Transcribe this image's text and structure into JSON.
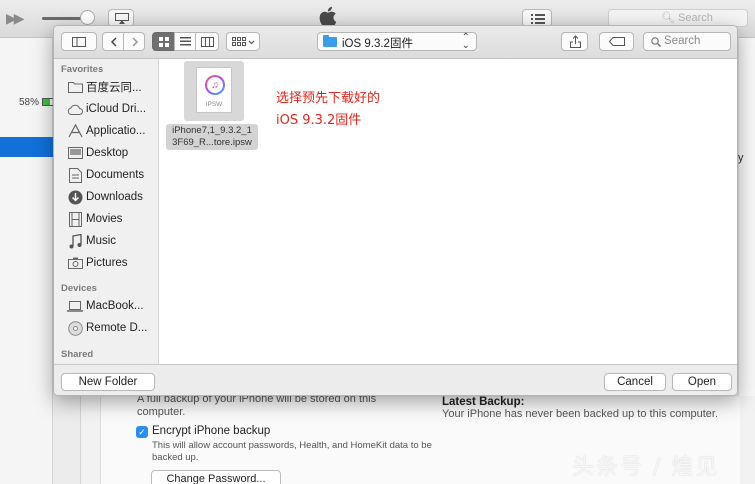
{
  "itunes": {
    "search_placeholder": "Search",
    "battery_percent": "58%",
    "backup": {
      "description": "A full backup of your iPhone will be stored on this computer.",
      "encrypt_label": "Encrypt iPhone backup",
      "encrypt_checked": true,
      "encrypt_description": "This will allow account passwords, Health, and HomeKit data to be backed up.",
      "change_password_label": "Change Password...",
      "latest_backup_title": "Latest Backup:",
      "latest_backup_text": "Your iPhone has never been backed up to this computer."
    },
    "right_edge_char": "y"
  },
  "dialog": {
    "location": "iOS 9.3.2固件",
    "search_placeholder": "Search",
    "sidebar": {
      "favorites_header": "Favorites",
      "favorites": [
        {
          "label": "百度云同...",
          "icon": "folder-icon"
        },
        {
          "label": "iCloud Dri...",
          "icon": "cloud-icon"
        },
        {
          "label": "Applicatio...",
          "icon": "applications-icon"
        },
        {
          "label": "Desktop",
          "icon": "desktop-icon"
        },
        {
          "label": "Documents",
          "icon": "documents-icon"
        },
        {
          "label": "Downloads",
          "icon": "downloads-icon"
        },
        {
          "label": "Movies",
          "icon": "movies-icon"
        },
        {
          "label": "Music",
          "icon": "music-icon"
        },
        {
          "label": "Pictures",
          "icon": "pictures-icon"
        }
      ],
      "devices_header": "Devices",
      "devices": [
        {
          "label": "MacBook...",
          "icon": "laptop-icon"
        },
        {
          "label": "Remote D...",
          "icon": "disc-icon"
        }
      ],
      "shared_header": "Shared"
    },
    "files": [
      {
        "name_line1": "iPhone7,1_9.3.2_1",
        "name_line2": "3F69_R...tore.ipsw",
        "ext_label": "IPSW",
        "icon": "ipsw-file-icon",
        "selected": true
      }
    ],
    "annotation": {
      "line1": "选择预先下载好的",
      "line2": "iOS 9.3.2固件",
      "color": "#e1251b"
    },
    "footer": {
      "new_folder_label": "New Folder",
      "cancel_label": "Cancel",
      "open_label": "Open"
    }
  },
  "watermark": "头条号 / 煌见"
}
